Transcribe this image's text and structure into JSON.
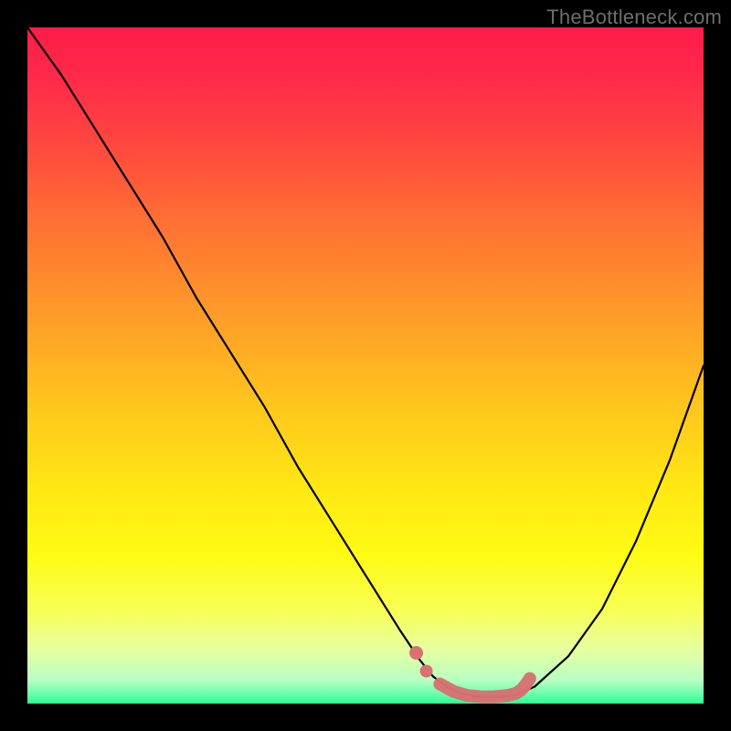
{
  "watermark": "TheBottleneck.com",
  "colors": {
    "bg": "#000000",
    "curve": "#000000",
    "marker_stroke": "#d87171",
    "marker_fill": "#d87171",
    "gradient_stops": [
      {
        "offset": 0.0,
        "color": "#ff1b4b"
      },
      {
        "offset": 0.08,
        "color": "#ff2b4a"
      },
      {
        "offset": 0.18,
        "color": "#ff4a3e"
      },
      {
        "offset": 0.3,
        "color": "#ff7433"
      },
      {
        "offset": 0.42,
        "color": "#ff9a29"
      },
      {
        "offset": 0.55,
        "color": "#ffc31e"
      },
      {
        "offset": 0.68,
        "color": "#ffe714"
      },
      {
        "offset": 0.78,
        "color": "#fffb13"
      },
      {
        "offset": 0.86,
        "color": "#f8ff53"
      },
      {
        "offset": 0.92,
        "color": "#e6ffa0"
      },
      {
        "offset": 0.965,
        "color": "#b9ffc1"
      },
      {
        "offset": 0.985,
        "color": "#6dffad"
      },
      {
        "offset": 1.0,
        "color": "#2bfd8f"
      }
    ]
  },
  "chart_data": {
    "type": "line",
    "title": "",
    "xlabel": "",
    "ylabel": "",
    "xlim": [
      0,
      100
    ],
    "ylim": [
      0,
      100
    ],
    "series": [
      {
        "name": "bottleneck-curve",
        "x": [
          0,
          5,
          10,
          15,
          20,
          25,
          30,
          35,
          40,
          45,
          50,
          55,
          58,
          60,
          62,
          64,
          66,
          68,
          70,
          72,
          75,
          80,
          85,
          90,
          95,
          100
        ],
        "y": [
          100,
          93,
          85,
          77,
          69,
          60,
          52,
          44,
          35,
          27,
          19,
          11,
          6.5,
          4,
          2.5,
          1.6,
          1.1,
          1.0,
          1.0,
          1.2,
          2.5,
          7,
          14,
          24,
          36,
          50
        ]
      }
    ],
    "markers": {
      "name": "highlight-band",
      "x": [
        57.5,
        59,
        61,
        63,
        65,
        67,
        69,
        71,
        72.2,
        73,
        73.7,
        74.3
      ],
      "y": [
        7.5,
        4.8,
        2.9,
        1.8,
        1.2,
        1.0,
        1.0,
        1.2,
        1.5,
        2.0,
        2.8,
        3.7
      ]
    }
  }
}
